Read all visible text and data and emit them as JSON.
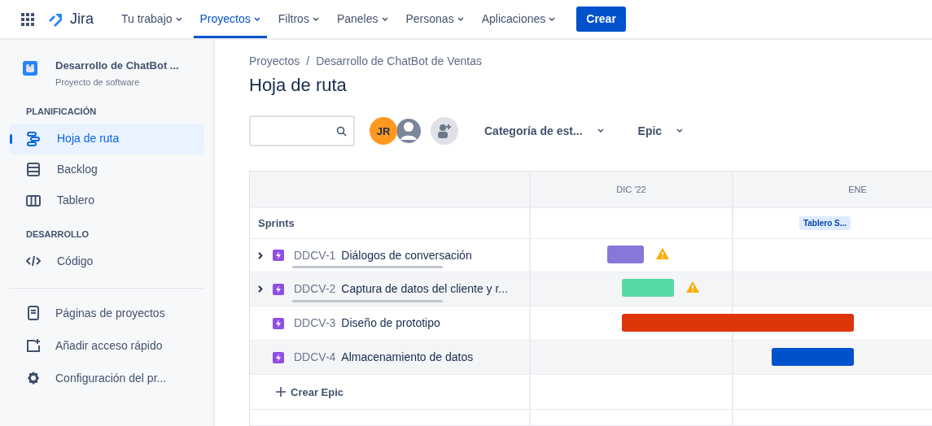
{
  "topnav": {
    "product": "Jira",
    "menus": [
      {
        "label": "Tu trabajo",
        "selected": false
      },
      {
        "label": "Proyectos",
        "selected": true
      },
      {
        "label": "Filtros",
        "selected": false
      },
      {
        "label": "Paneles",
        "selected": false
      },
      {
        "label": "Personas",
        "selected": false
      },
      {
        "label": "Aplicaciones",
        "selected": false
      }
    ],
    "create_button": "Crear"
  },
  "sidebar": {
    "project_name": "Desarrollo de ChatBot ...",
    "project_type": "Proyecto de software",
    "sections": [
      {
        "title": "PLANIFICACIÓN",
        "items": [
          {
            "label": "Hoja de ruta",
            "selected": true
          },
          {
            "label": "Backlog",
            "selected": false
          },
          {
            "label": "Tablero",
            "selected": false
          }
        ]
      },
      {
        "title": "DESARROLLO",
        "items": [
          {
            "label": "Código",
            "selected": false
          }
        ]
      }
    ],
    "footer_items": [
      {
        "label": "Páginas de proyectos"
      },
      {
        "label": "Añadir acceso rápido"
      },
      {
        "label": "Configuración del pr..."
      }
    ]
  },
  "breadcrumbs": [
    "Proyectos",
    "/",
    "Desarrollo de ChatBot de Ventas"
  ],
  "page_title": "Hoja de ruta",
  "toolbar": {
    "avatar_initials": "JR",
    "filters": [
      "Categoría de est...",
      "Epic"
    ]
  },
  "roadmap": {
    "months": [
      "DIC '22",
      "ENE"
    ],
    "sprints_label": "Sprints",
    "sprint_chip": "Tablero S...",
    "epics": [
      {
        "key": "DDCV-1",
        "title": "Diálogos de conversación",
        "expandable": true,
        "progress": {
          "level": 0
        },
        "color": "#8777d9",
        "warning": true
      },
      {
        "key": "DDCV-2",
        "title": "Captura de datos del cliente y r...",
        "expandable": true,
        "progress": {
          "level": 0
        },
        "color": "#57d9a3",
        "warning": true
      },
      {
        "key": "DDCV-3",
        "title": "Diseño de prototipo",
        "expandable": false,
        "color": "#de350b",
        "warning": false
      },
      {
        "key": "DDCV-4",
        "title": "Almacenamiento de datos",
        "expandable": false,
        "color": "#0052cc",
        "warning": false
      }
    ],
    "create_label": "Crear Epic"
  }
}
